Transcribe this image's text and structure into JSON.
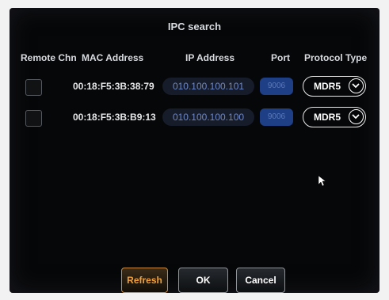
{
  "dialog": {
    "title": "IPC search"
  },
  "columns": {
    "remote_chn": "Remote Chn",
    "mac": "MAC Address",
    "ip": "IP Address",
    "port": "Port",
    "protocol": "Protocol Type"
  },
  "rows": [
    {
      "mac": "00:18:F5:3B:38:79",
      "ip": "010.100.100.101",
      "port": "9006",
      "protocol": "MDR5"
    },
    {
      "mac": "00:18:F5:3B:B9:13",
      "ip": "010.100.100.100",
      "port": "9006",
      "protocol": "MDR5"
    }
  ],
  "buttons": {
    "refresh": "Refresh",
    "ok": "OK",
    "cancel": "Cancel"
  },
  "colors": {
    "accent": "#f1a13a",
    "port_field": "#1e3e86",
    "ip_text": "#6e88c8"
  },
  "icons": {
    "dropdown": "chevron-down-icon",
    "pointer": "mouse-pointer-icon"
  }
}
